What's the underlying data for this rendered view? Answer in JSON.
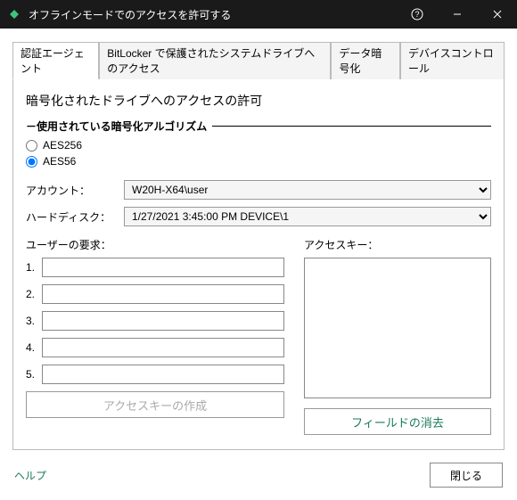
{
  "window": {
    "title": "オフラインモードでのアクセスを許可する"
  },
  "tabs": {
    "t0": "認証エージェント",
    "t1": "BitLocker で保護されたシステムドライブへのアクセス",
    "t2": "データ暗号化",
    "t3": "デバイスコントロール"
  },
  "panel": {
    "heading": "暗号化されたドライブへのアクセスの許可",
    "group_title": "－使用されている暗号化アルゴリズム",
    "radio_aes256": "AES256",
    "radio_aes56": "AES56",
    "account_label": "アカウント：",
    "account_value": "W20H-X64\\user",
    "harddisk_label": "ハードディスク：",
    "harddisk_value": "1/27/2021 3:45:00 PM  DEVICE\\1",
    "user_request_label": "ユーザーの要求：",
    "access_key_label": "アクセスキー：",
    "nums": {
      "n1": "1.",
      "n2": "2.",
      "n3": "3.",
      "n4": "4.",
      "n5": "5."
    },
    "create_btn": "アクセスキーの作成",
    "clear_btn": "フィールドの消去"
  },
  "footer": {
    "help": "ヘルプ",
    "close": "閉じる"
  }
}
